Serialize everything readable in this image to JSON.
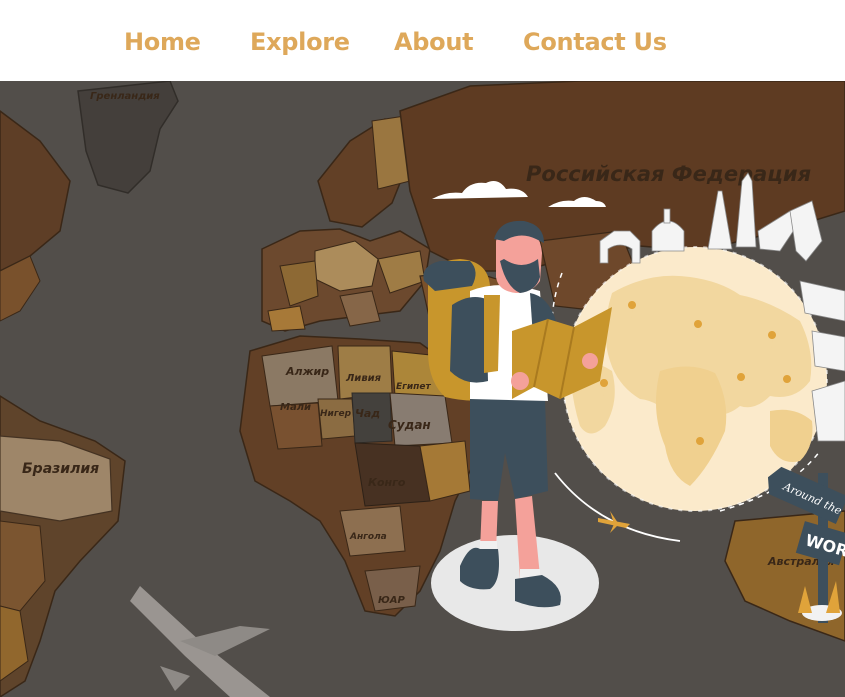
{
  "nav": {
    "items": [
      {
        "label": "Home"
      },
      {
        "label": "Explore"
      },
      {
        "label": "About"
      },
      {
        "label": "Contact Us"
      }
    ],
    "color": "#dea85a"
  },
  "hero": {
    "map_labels": {
      "greenland": "Гренландия",
      "russia": "Российская Федерация",
      "brazil": "Бразилия",
      "algeria": "Алжир",
      "libya": "Ливия",
      "egypt": "Египет",
      "mali": "Мали",
      "niger": "Нигер",
      "chad": "Чад",
      "sudan": "Судан",
      "congo": "Конго",
      "angola": "Ангола",
      "south_africa": "ЮАР",
      "australia": "Австралия"
    },
    "signpost": {
      "line1": "Around the",
      "line2": "WORLD"
    },
    "overlay_color": "#55504c"
  }
}
